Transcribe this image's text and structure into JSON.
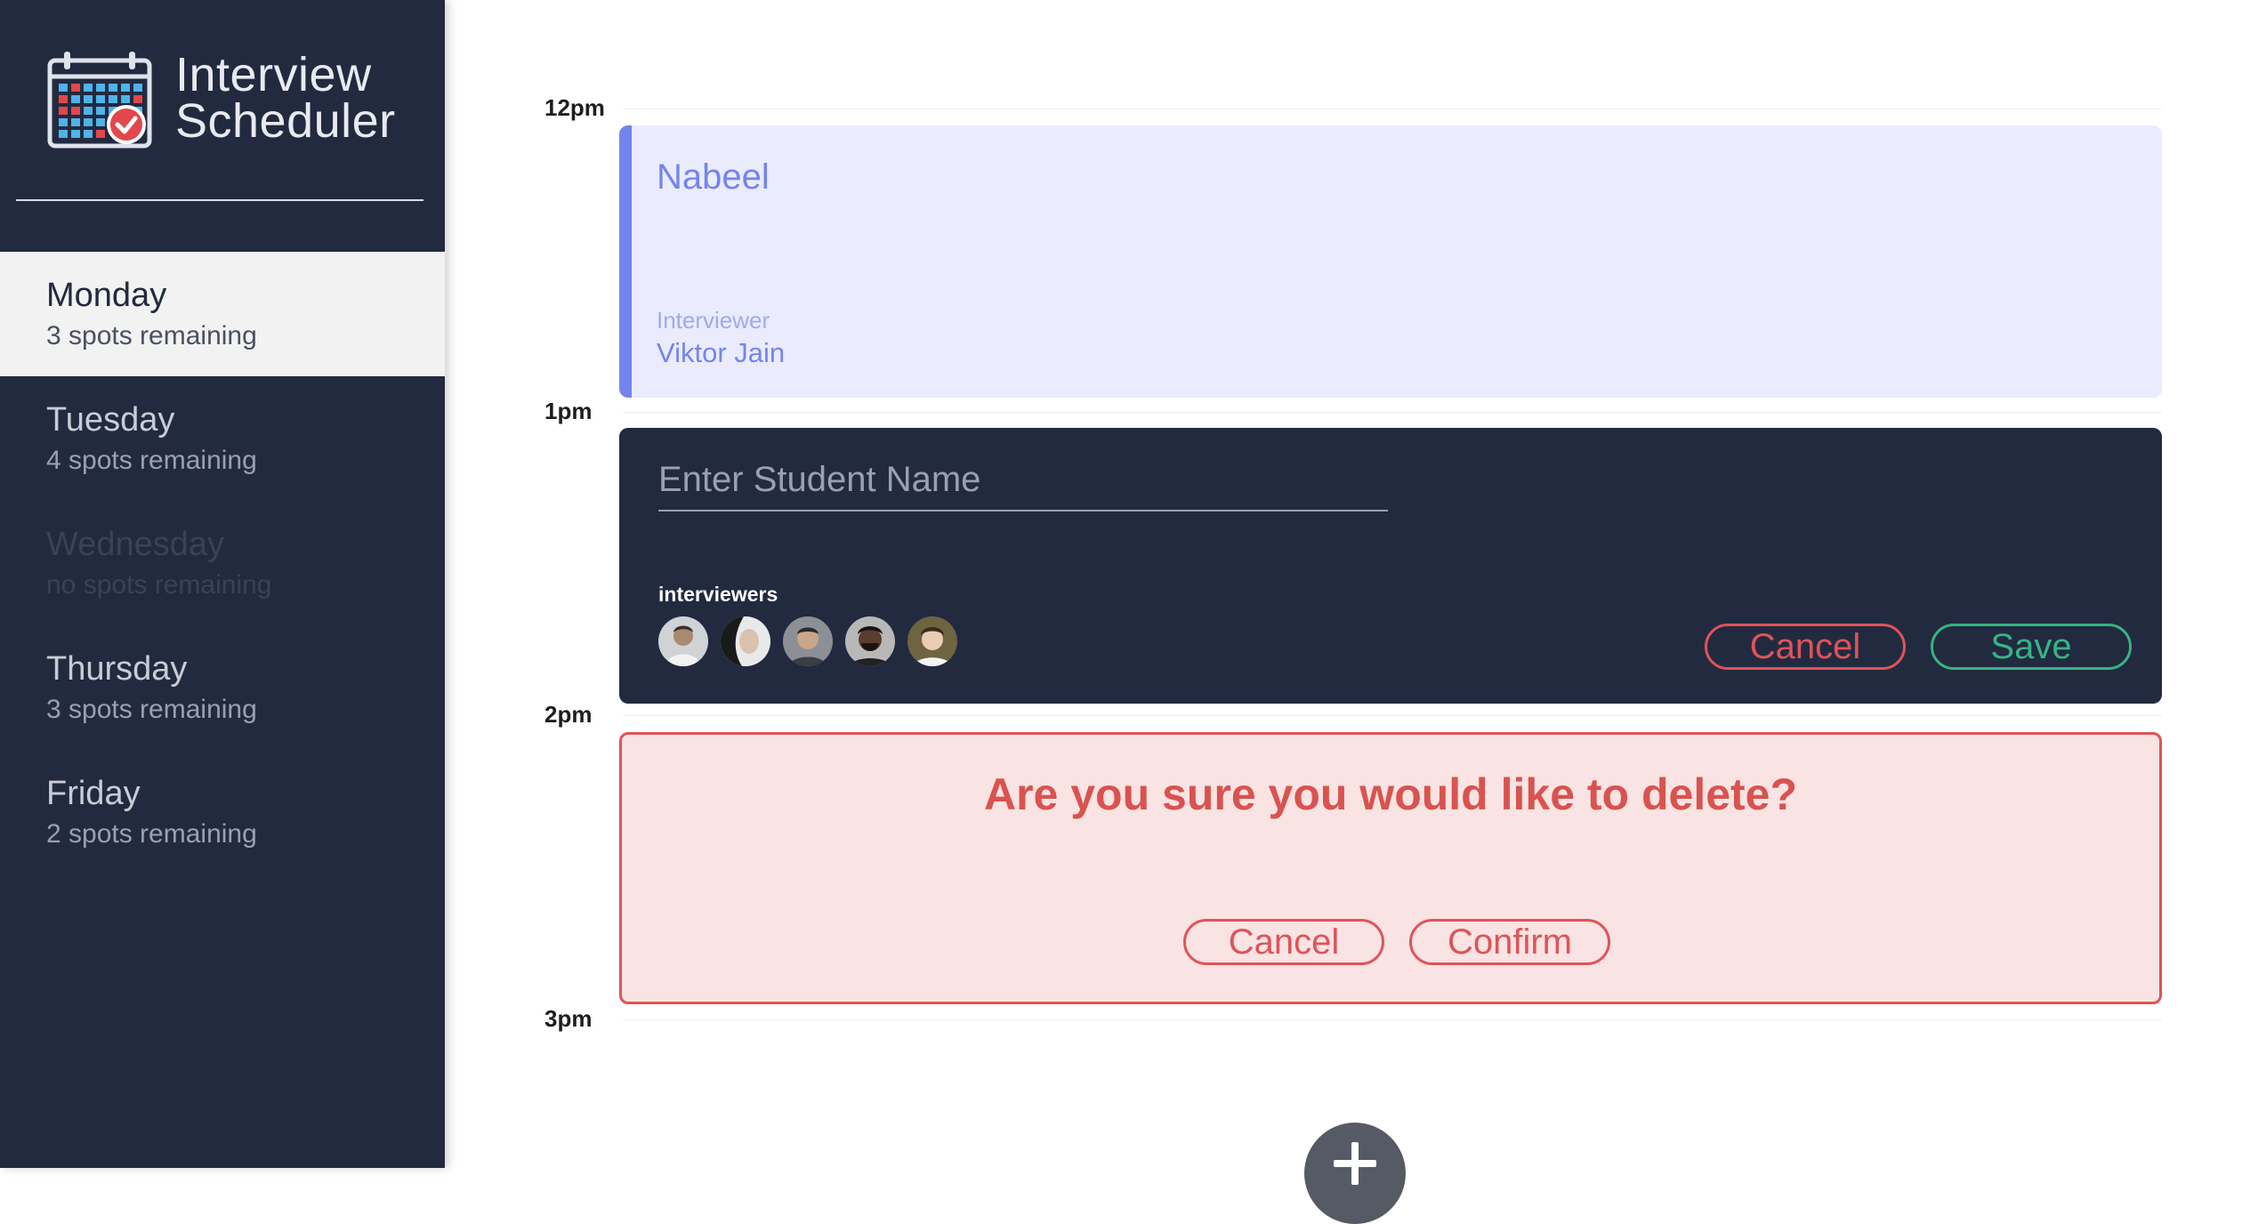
{
  "app": {
    "name_line1": "Interview",
    "name_line2": "Scheduler",
    "logo_icon": "calendar-check-icon"
  },
  "sidebar": {
    "days": [
      {
        "name": "Monday",
        "spots": "3 spots remaining",
        "selected": true,
        "full": false
      },
      {
        "name": "Tuesday",
        "spots": "4 spots remaining",
        "selected": false,
        "full": false
      },
      {
        "name": "Wednesday",
        "spots": "no spots remaining",
        "selected": false,
        "full": true
      },
      {
        "name": "Thursday",
        "spots": "3 spots remaining",
        "selected": false,
        "full": false
      },
      {
        "name": "Friday",
        "spots": "2 spots remaining",
        "selected": false,
        "full": false
      }
    ]
  },
  "schedule": {
    "times": [
      "12pm",
      "1pm",
      "2pm",
      "3pm"
    ],
    "show": {
      "student": "Nabeel",
      "interviewer_label": "Interviewer",
      "interviewer_name": "Viktor Jain"
    },
    "form": {
      "placeholder": "Enter Student Name",
      "interviewers_label": "interviewers",
      "cancel_label": "Cancel",
      "save_label": "Save"
    },
    "confirm": {
      "message": "Are you sure you would like to delete?",
      "cancel_label": "Cancel",
      "confirm_label": "Confirm"
    },
    "add_icon": "plus-icon"
  },
  "colors": {
    "sidebar_bg": "#222a40",
    "accent": "#7484ee",
    "danger": "#e05358",
    "success": "#36b482"
  }
}
